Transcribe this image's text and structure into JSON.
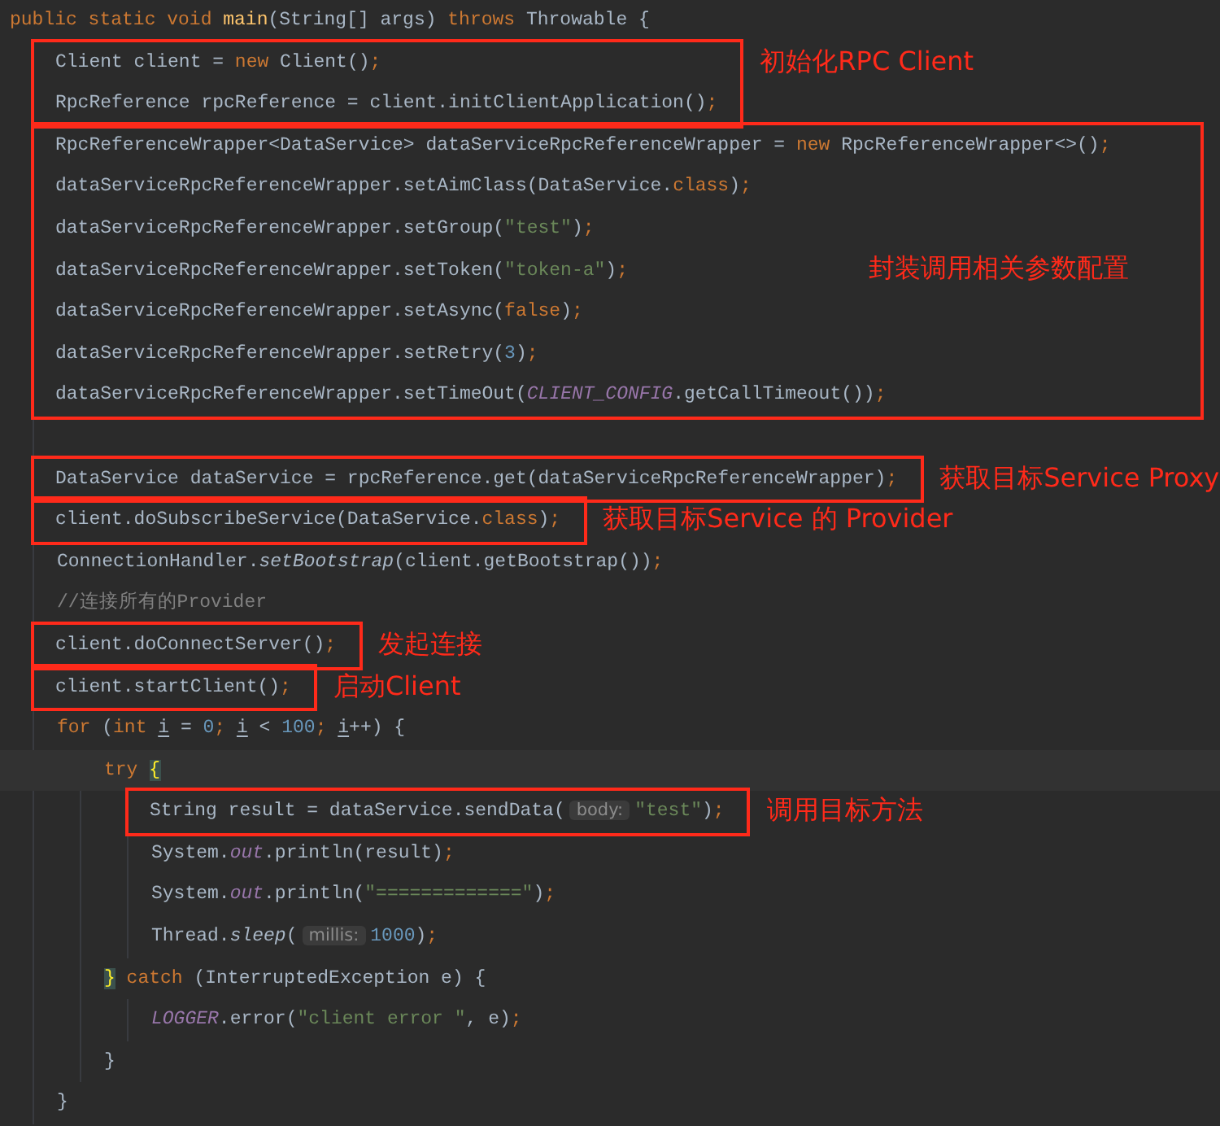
{
  "editor": {
    "lines": [
      {
        "kind": "line",
        "tokens": [
          {
            "kind": "keyword",
            "text": "public static void "
          },
          {
            "kind": "method_decl",
            "text": "main"
          },
          {
            "kind": "plain",
            "text": "(String[] args) "
          },
          {
            "kind": "keyword",
            "text": "throws"
          },
          {
            "kind": "plain",
            "text": " Throwable {"
          }
        ],
        "children": [
          {
            "kind": "group",
            "note_inside": false,
            "note": "初始化RPC Client",
            "lines": [
              {
                "kind": "line",
                "tokens": [
                  {
                    "kind": "plain",
                    "text": "Client client = "
                  },
                  {
                    "kind": "keyword",
                    "text": "new"
                  },
                  {
                    "kind": "plain",
                    "text": " Client()"
                  },
                  {
                    "kind": "semi",
                    "text": ";"
                  }
                ]
              },
              {
                "kind": "line",
                "tokens": [
                  {
                    "kind": "plain",
                    "text": "RpcReference rpcReference = client.initClientApplication()"
                  },
                  {
                    "kind": "semi",
                    "text": ";"
                  }
                ]
              }
            ]
          },
          {
            "kind": "group",
            "note_inside": true,
            "note": "封装调用相关参数配置",
            "lines": [
              {
                "kind": "line",
                "tokens": [
                  {
                    "kind": "plain",
                    "text": "RpcReferenceWrapper<DataService> dataServiceRpcReferenceWrapper = "
                  },
                  {
                    "kind": "keyword",
                    "text": "new"
                  },
                  {
                    "kind": "plain",
                    "text": " RpcReferenceWrapper<>()"
                  },
                  {
                    "kind": "semi",
                    "text": ";"
                  }
                ]
              },
              {
                "kind": "line",
                "tokens": [
                  {
                    "kind": "plain",
                    "text": "dataServiceRpcReferenceWrapper.setAimClass(DataService."
                  },
                  {
                    "kind": "keyword",
                    "text": "class"
                  },
                  {
                    "kind": "plain",
                    "text": ")"
                  },
                  {
                    "kind": "semi",
                    "text": ";"
                  }
                ]
              },
              {
                "kind": "line",
                "tokens": [
                  {
                    "kind": "plain",
                    "text": "dataServiceRpcReferenceWrapper.setGroup("
                  },
                  {
                    "kind": "string",
                    "text": "\"test\""
                  },
                  {
                    "kind": "plain",
                    "text": ")"
                  },
                  {
                    "kind": "semi",
                    "text": ";"
                  }
                ]
              },
              {
                "kind": "line",
                "tokens": [
                  {
                    "kind": "plain",
                    "text": "dataServiceRpcReferenceWrapper.setToken("
                  },
                  {
                    "kind": "string",
                    "text": "\"token-a\""
                  },
                  {
                    "kind": "plain",
                    "text": ")"
                  },
                  {
                    "kind": "semi",
                    "text": ";"
                  }
                ]
              },
              {
                "kind": "line",
                "tokens": [
                  {
                    "kind": "plain",
                    "text": "dataServiceRpcReferenceWrapper.setAsync("
                  },
                  {
                    "kind": "keyword",
                    "text": "false"
                  },
                  {
                    "kind": "plain",
                    "text": ")"
                  },
                  {
                    "kind": "semi",
                    "text": ";"
                  }
                ]
              },
              {
                "kind": "line",
                "tokens": [
                  {
                    "kind": "plain",
                    "text": "dataServiceRpcReferenceWrapper.setRetry("
                  },
                  {
                    "kind": "number",
                    "text": "3"
                  },
                  {
                    "kind": "plain",
                    "text": ")"
                  },
                  {
                    "kind": "semi",
                    "text": ";"
                  }
                ]
              },
              {
                "kind": "line",
                "tokens": [
                  {
                    "kind": "plain",
                    "text": "dataServiceRpcReferenceWrapper.setTimeOut("
                  },
                  {
                    "kind": "constant",
                    "text": "CLIENT_CONFIG"
                  },
                  {
                    "kind": "plain",
                    "text": ".getCallTimeout())"
                  },
                  {
                    "kind": "semi",
                    "text": ";"
                  }
                ]
              }
            ]
          },
          {
            "kind": "blank"
          },
          {
            "kind": "group",
            "note_inside": false,
            "note": "获取目标Service Proxy",
            "lines": [
              {
                "kind": "line",
                "tokens": [
                  {
                    "kind": "plain",
                    "text": "DataService dataService = rpcReference.get(dataServiceRpcReferenceWrapper)"
                  },
                  {
                    "kind": "semi",
                    "text": ";"
                  }
                ]
              }
            ]
          },
          {
            "kind": "group",
            "note_inside": false,
            "note": "获取目标Service 的 Provider",
            "lines": [
              {
                "kind": "line",
                "tokens": [
                  {
                    "kind": "plain",
                    "text": "client.doSubscribeService(DataService."
                  },
                  {
                    "kind": "keyword",
                    "text": "class"
                  },
                  {
                    "kind": "plain",
                    "text": ")"
                  },
                  {
                    "kind": "semi",
                    "text": ";"
                  }
                ]
              }
            ]
          },
          {
            "kind": "line",
            "tokens": [
              {
                "kind": "plain",
                "text": "ConnectionHandler."
              },
              {
                "kind": "static_call",
                "text": "setBootstrap"
              },
              {
                "kind": "plain",
                "text": "(client.getBootstrap())"
              },
              {
                "kind": "semi",
                "text": ";"
              }
            ]
          },
          {
            "kind": "line",
            "tokens": [
              {
                "kind": "comment",
                "text": "//连接所有的Provider"
              }
            ]
          },
          {
            "kind": "group",
            "note_inside": false,
            "note": "发起连接",
            "lines": [
              {
                "kind": "line",
                "tokens": [
                  {
                    "kind": "plain",
                    "text": "client.doConnectServer()"
                  },
                  {
                    "kind": "semi",
                    "text": ";"
                  }
                ]
              }
            ]
          },
          {
            "kind": "group",
            "note_inside": false,
            "note": "启动Client",
            "lines": [
              {
                "kind": "line",
                "tokens": [
                  {
                    "kind": "plain",
                    "text": "client.startClient()"
                  },
                  {
                    "kind": "semi",
                    "text": ";"
                  }
                ]
              }
            ]
          },
          {
            "kind": "line",
            "tokens": [
              {
                "kind": "keyword",
                "text": "for"
              },
              {
                "kind": "plain",
                "text": " ("
              },
              {
                "kind": "keyword",
                "text": "int "
              },
              {
                "kind": "underlined",
                "text": "i"
              },
              {
                "kind": "plain",
                "text": " = "
              },
              {
                "kind": "number",
                "text": "0"
              },
              {
                "kind": "semi",
                "text": "; "
              },
              {
                "kind": "underlined",
                "text": "i"
              },
              {
                "kind": "plain",
                "text": " < "
              },
              {
                "kind": "number",
                "text": "100"
              },
              {
                "kind": "semi",
                "text": "; "
              },
              {
                "kind": "underlined",
                "text": "i"
              },
              {
                "kind": "plain",
                "text": "++) {"
              }
            ],
            "children": [
              {
                "kind": "line",
                "current": true,
                "tokens": [
                  {
                    "kind": "keyword",
                    "text": "try "
                  },
                  {
                    "kind": "brace_match",
                    "text": "{"
                  }
                ],
                "children": [
                  {
                    "kind": "group",
                    "note_inside": false,
                    "note": "调用目标方法",
                    "lines": [
                      {
                        "kind": "line",
                        "tokens": [
                          {
                            "kind": "plain",
                            "text": "String result = dataService.sendData("
                          },
                          {
                            "kind": "hint",
                            "text": "body:"
                          },
                          {
                            "kind": "string",
                            "text": "\"test\""
                          },
                          {
                            "kind": "plain",
                            "text": ")"
                          },
                          {
                            "kind": "semi",
                            "text": ";"
                          }
                        ]
                      }
                    ]
                  },
                  {
                    "kind": "line",
                    "tokens": [
                      {
                        "kind": "plain",
                        "text": "System."
                      },
                      {
                        "kind": "constant",
                        "text": "out"
                      },
                      {
                        "kind": "plain",
                        "text": ".println(result)"
                      },
                      {
                        "kind": "semi",
                        "text": ";"
                      }
                    ]
                  },
                  {
                    "kind": "line",
                    "tokens": [
                      {
                        "kind": "plain",
                        "text": "System."
                      },
                      {
                        "kind": "constant",
                        "text": "out"
                      },
                      {
                        "kind": "plain",
                        "text": ".println("
                      },
                      {
                        "kind": "string",
                        "text": "\"=============\""
                      },
                      {
                        "kind": "plain",
                        "text": ")"
                      },
                      {
                        "kind": "semi",
                        "text": ";"
                      }
                    ]
                  },
                  {
                    "kind": "line",
                    "tokens": [
                      {
                        "kind": "plain",
                        "text": "Thread."
                      },
                      {
                        "kind": "static_call",
                        "text": "sleep"
                      },
                      {
                        "kind": "plain",
                        "text": "("
                      },
                      {
                        "kind": "hint",
                        "text": "millis:"
                      },
                      {
                        "kind": "number",
                        "text": "1000"
                      },
                      {
                        "kind": "plain",
                        "text": ")"
                      },
                      {
                        "kind": "semi",
                        "text": ";"
                      }
                    ]
                  }
                ]
              },
              {
                "kind": "line",
                "tokens": [
                  {
                    "kind": "brace_match",
                    "text": "}"
                  },
                  {
                    "kind": "keyword",
                    "text": " catch"
                  },
                  {
                    "kind": "plain",
                    "text": " (InterruptedException e) {"
                  }
                ],
                "children": [
                  {
                    "kind": "line",
                    "tokens": [
                      {
                        "kind": "constant",
                        "text": "LOGGER"
                      },
                      {
                        "kind": "plain",
                        "text": ".error("
                      },
                      {
                        "kind": "string",
                        "text": "\"client error \""
                      },
                      {
                        "kind": "plain",
                        "text": ", e)"
                      },
                      {
                        "kind": "semi",
                        "text": ";"
                      }
                    ]
                  }
                ]
              },
              {
                "kind": "line",
                "tokens": [
                  {
                    "kind": "plain",
                    "text": "}"
                  }
                ]
              }
            ]
          },
          {
            "kind": "line",
            "tokens": [
              {
                "kind": "plain",
                "text": "}"
              }
            ]
          }
        ]
      }
    ]
  }
}
